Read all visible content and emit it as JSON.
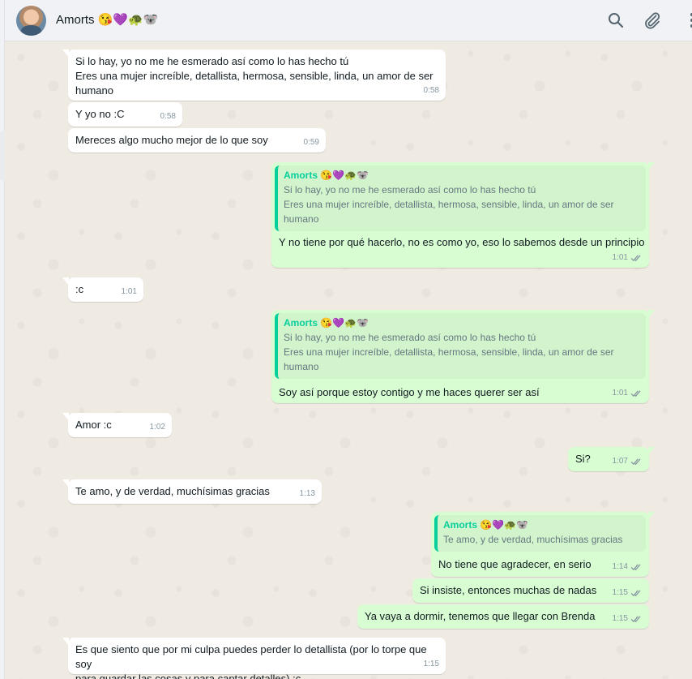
{
  "header": {
    "contact_name": "Amorts 😘💜🐢🐨",
    "icons": [
      "search-icon",
      "paperclip-icon",
      "menu-icon"
    ]
  },
  "colors": {
    "incoming": "#ffffff",
    "outgoing": "#d9fdd3",
    "quote_accent": "#06cf9c",
    "background": "#efeae2",
    "read_ticks": "#8696a0"
  },
  "messages": [
    {
      "dir": "in",
      "text": "Si lo hay, yo no me he esmerado así como lo has hecho tú\nEres una mujer increíble, detallista, hermosa, sensible, linda, un amor de ser humano",
      "time": "0:58"
    },
    {
      "dir": "in",
      "text": "Y yo no :C",
      "time": "0:58"
    },
    {
      "dir": "in",
      "text": "Mereces algo mucho mejor de lo que soy",
      "time": "0:59"
    },
    {
      "dir": "out",
      "quote_name": "Amorts 😘💜🐢🐨",
      "quote_text": "Si lo hay, yo no me he esmerado así como lo has hecho tú\nEres una mujer increíble, detallista, hermosa, sensible, linda, un amor de ser humano",
      "text": "Y no tiene por qué hacerlo, no es como yo, eso lo sabemos desde un principio",
      "time": "1:01"
    },
    {
      "dir": "in",
      "text": ":c",
      "time": "1:01"
    },
    {
      "dir": "out",
      "quote_name": "Amorts 😘💜🐢🐨",
      "quote_text": "Si lo hay, yo no me he esmerado así como lo has hecho tú\nEres una mujer increíble, detallista, hermosa, sensible, linda, un amor de ser humano",
      "text": "Soy así porque estoy contigo y me haces querer ser así",
      "time": "1:01"
    },
    {
      "dir": "in",
      "text": "Amor :c",
      "time": "1:02"
    },
    {
      "dir": "out",
      "text": "Si?",
      "time": "1:07"
    },
    {
      "dir": "in",
      "text": "Te amo, y de verdad, muchísimas gracias",
      "time": "1:13"
    },
    {
      "dir": "out",
      "quote_name": "Amorts 😘💜🐢🐨",
      "quote_text": "Te amo, y de verdad, muchísimas gracias",
      "text": "No tiene que agradecer, en serio",
      "time": "1:14"
    },
    {
      "dir": "out",
      "text": "Si insiste, entonces muchas de nadas",
      "time": "1:15"
    },
    {
      "dir": "out",
      "text": "Ya vaya a dormir, tenemos que llegar con Brenda",
      "time": "1:15"
    },
    {
      "dir": "in",
      "text": "Es que siento que por mi culpa puedes perder lo detallista (por lo torpe que soy\npara guardar las cosas y para captar detalles) :c",
      "time": "1:15"
    }
  ]
}
